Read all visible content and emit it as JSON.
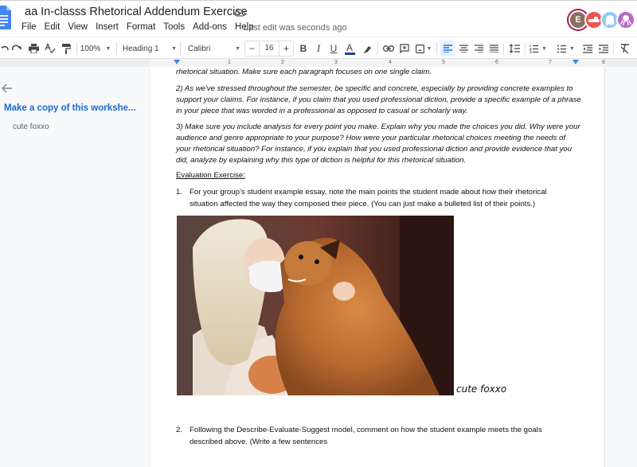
{
  "header": {
    "title": "aa In-classs Rhetorical Addendum Exercise",
    "last_edit": "Last edit was seconds ago",
    "menu": [
      "File",
      "Edit",
      "View",
      "Insert",
      "Format",
      "Tools",
      "Add-ons",
      "Help"
    ],
    "avatars": [
      {
        "label": "E",
        "color": "#8d6e63",
        "ring": "#ad1457"
      },
      {
        "label": "",
        "icon": "crocodile-avatar",
        "color": "#ef5350"
      },
      {
        "label": "",
        "icon": "ghost-avatar",
        "color": "#90caf9"
      },
      {
        "label": "",
        "icon": "octopus-avatar",
        "color": "#ba68c8"
      }
    ]
  },
  "toolbar": {
    "zoom": "100%",
    "style": "Heading 1",
    "font": "Calibri",
    "font_size": "16",
    "minus": "−",
    "plus": "+",
    "bold": "B",
    "italic": "I",
    "underline": "U",
    "text_color": "A",
    "text_color_hex": "#1c3f94"
  },
  "ruler": {
    "numbers": [
      "1",
      "2",
      "3",
      "4",
      "5",
      "6",
      "7",
      "8"
    ]
  },
  "sidebar": {
    "heading": "Make a copy of this workshe...",
    "items": [
      "cute foxxo"
    ]
  },
  "document": {
    "para0": "rhetorical situation. Make sure each paragraph focuses on one single claim.",
    "para2": "2) As we've stressed throughout the semester, be specific and concrete, especially by providing concrete examples to support your claims. For instance, if you claim that you used professional diction, provide a specific example of a phrase in your piece that was worded in a professional as opposed to casual or scholarly way.",
    "para3": "3) Make sure you include analysis for every point you make. Explain why you made the choices you did. Why were your audience and genre appropriate to your purpose? How were your particular rhetorical choices meeting the needs of your rhetorical situation? For instance, if you explain that you used professional diction and provide evidence that you did, analyze by explaining why this type of diction is helpful for this rhetorical situation.",
    "section_heading": "Evaluation Exercise:",
    "list": [
      {
        "num": "1.",
        "text": "For your group’s student example essay, note the main points the student made about how their rhetorical situation affected the way they composed their piece. (You can just make a bulleted list of their points.)"
      },
      {
        "num": "2.",
        "text": "Following the Describe-Evaluate-Suggest model, comment on how the student example meets the goals described above. (Write a few sentences"
      }
    ],
    "image_alt": "Woman with blonde hair wearing a face mask hugging a red fox",
    "image_caption": "cute foxxo"
  }
}
